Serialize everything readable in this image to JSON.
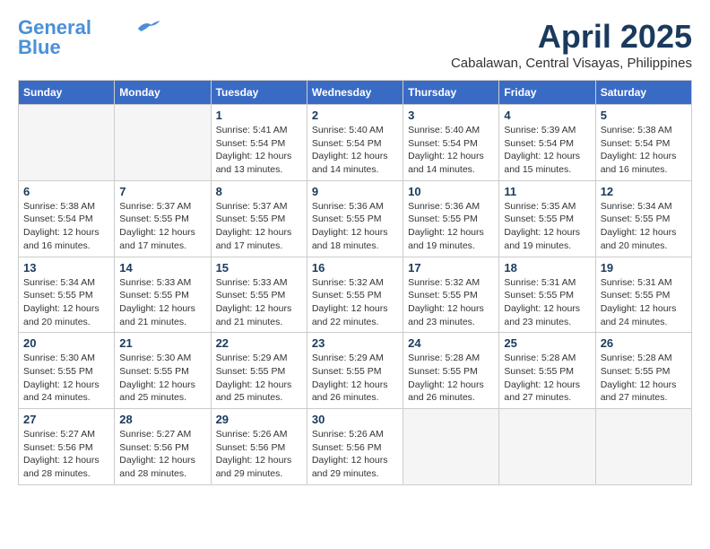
{
  "header": {
    "logo_line1": "General",
    "logo_line2": "Blue",
    "month": "April 2025",
    "location": "Cabalawan, Central Visayas, Philippines"
  },
  "days_of_week": [
    "Sunday",
    "Monday",
    "Tuesday",
    "Wednesday",
    "Thursday",
    "Friday",
    "Saturday"
  ],
  "weeks": [
    [
      {
        "num": "",
        "info": ""
      },
      {
        "num": "",
        "info": ""
      },
      {
        "num": "1",
        "info": "Sunrise: 5:41 AM\nSunset: 5:54 PM\nDaylight: 12 hours and 13 minutes."
      },
      {
        "num": "2",
        "info": "Sunrise: 5:40 AM\nSunset: 5:54 PM\nDaylight: 12 hours and 14 minutes."
      },
      {
        "num": "3",
        "info": "Sunrise: 5:40 AM\nSunset: 5:54 PM\nDaylight: 12 hours and 14 minutes."
      },
      {
        "num": "4",
        "info": "Sunrise: 5:39 AM\nSunset: 5:54 PM\nDaylight: 12 hours and 15 minutes."
      },
      {
        "num": "5",
        "info": "Sunrise: 5:38 AM\nSunset: 5:54 PM\nDaylight: 12 hours and 16 minutes."
      }
    ],
    [
      {
        "num": "6",
        "info": "Sunrise: 5:38 AM\nSunset: 5:54 PM\nDaylight: 12 hours and 16 minutes."
      },
      {
        "num": "7",
        "info": "Sunrise: 5:37 AM\nSunset: 5:55 PM\nDaylight: 12 hours and 17 minutes."
      },
      {
        "num": "8",
        "info": "Sunrise: 5:37 AM\nSunset: 5:55 PM\nDaylight: 12 hours and 17 minutes."
      },
      {
        "num": "9",
        "info": "Sunrise: 5:36 AM\nSunset: 5:55 PM\nDaylight: 12 hours and 18 minutes."
      },
      {
        "num": "10",
        "info": "Sunrise: 5:36 AM\nSunset: 5:55 PM\nDaylight: 12 hours and 19 minutes."
      },
      {
        "num": "11",
        "info": "Sunrise: 5:35 AM\nSunset: 5:55 PM\nDaylight: 12 hours and 19 minutes."
      },
      {
        "num": "12",
        "info": "Sunrise: 5:34 AM\nSunset: 5:55 PM\nDaylight: 12 hours and 20 minutes."
      }
    ],
    [
      {
        "num": "13",
        "info": "Sunrise: 5:34 AM\nSunset: 5:55 PM\nDaylight: 12 hours and 20 minutes."
      },
      {
        "num": "14",
        "info": "Sunrise: 5:33 AM\nSunset: 5:55 PM\nDaylight: 12 hours and 21 minutes."
      },
      {
        "num": "15",
        "info": "Sunrise: 5:33 AM\nSunset: 5:55 PM\nDaylight: 12 hours and 21 minutes."
      },
      {
        "num": "16",
        "info": "Sunrise: 5:32 AM\nSunset: 5:55 PM\nDaylight: 12 hours and 22 minutes."
      },
      {
        "num": "17",
        "info": "Sunrise: 5:32 AM\nSunset: 5:55 PM\nDaylight: 12 hours and 23 minutes."
      },
      {
        "num": "18",
        "info": "Sunrise: 5:31 AM\nSunset: 5:55 PM\nDaylight: 12 hours and 23 minutes."
      },
      {
        "num": "19",
        "info": "Sunrise: 5:31 AM\nSunset: 5:55 PM\nDaylight: 12 hours and 24 minutes."
      }
    ],
    [
      {
        "num": "20",
        "info": "Sunrise: 5:30 AM\nSunset: 5:55 PM\nDaylight: 12 hours and 24 minutes."
      },
      {
        "num": "21",
        "info": "Sunrise: 5:30 AM\nSunset: 5:55 PM\nDaylight: 12 hours and 25 minutes."
      },
      {
        "num": "22",
        "info": "Sunrise: 5:29 AM\nSunset: 5:55 PM\nDaylight: 12 hours and 25 minutes."
      },
      {
        "num": "23",
        "info": "Sunrise: 5:29 AM\nSunset: 5:55 PM\nDaylight: 12 hours and 26 minutes."
      },
      {
        "num": "24",
        "info": "Sunrise: 5:28 AM\nSunset: 5:55 PM\nDaylight: 12 hours and 26 minutes."
      },
      {
        "num": "25",
        "info": "Sunrise: 5:28 AM\nSunset: 5:55 PM\nDaylight: 12 hours and 27 minutes."
      },
      {
        "num": "26",
        "info": "Sunrise: 5:28 AM\nSunset: 5:55 PM\nDaylight: 12 hours and 27 minutes."
      }
    ],
    [
      {
        "num": "27",
        "info": "Sunrise: 5:27 AM\nSunset: 5:56 PM\nDaylight: 12 hours and 28 minutes."
      },
      {
        "num": "28",
        "info": "Sunrise: 5:27 AM\nSunset: 5:56 PM\nDaylight: 12 hours and 28 minutes."
      },
      {
        "num": "29",
        "info": "Sunrise: 5:26 AM\nSunset: 5:56 PM\nDaylight: 12 hours and 29 minutes."
      },
      {
        "num": "30",
        "info": "Sunrise: 5:26 AM\nSunset: 5:56 PM\nDaylight: 12 hours and 29 minutes."
      },
      {
        "num": "",
        "info": ""
      },
      {
        "num": "",
        "info": ""
      },
      {
        "num": "",
        "info": ""
      }
    ]
  ]
}
